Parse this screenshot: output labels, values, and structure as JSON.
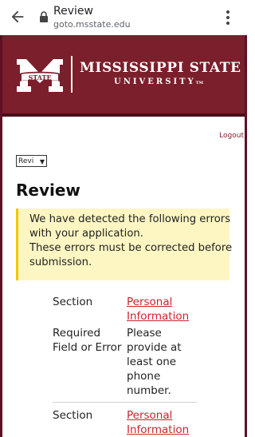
{
  "browser": {
    "title": "Review",
    "url": "goto.msstate.edu",
    "back_icon": "arrow-left-icon",
    "lock_icon": "lock-icon",
    "menu_icon": "more-vert-icon"
  },
  "banner": {
    "logo_text": "STATE",
    "name": "MISSISSIPPI STATE",
    "sub": "UNIVERSITY",
    "sub_mark": "TM",
    "color": "#7a1f2b"
  },
  "header": {
    "logout": "Logout"
  },
  "select": {
    "value": "Revi"
  },
  "page": {
    "heading": "Review"
  },
  "alert": {
    "lines": [
      "We have detected the following errors",
      "with your application.",
      "These errors must be corrected before",
      "submission."
    ]
  },
  "errors": [
    {
      "section_label": "Section",
      "section_value": [
        "Personal",
        "Information"
      ],
      "field_label": [
        "Required",
        "Field or Error"
      ],
      "message": [
        "Please",
        "provide at",
        "least one",
        "phone",
        "number."
      ]
    },
    {
      "section_label": "Section",
      "section_value": [
        "Personal",
        "Information"
      ]
    }
  ]
}
